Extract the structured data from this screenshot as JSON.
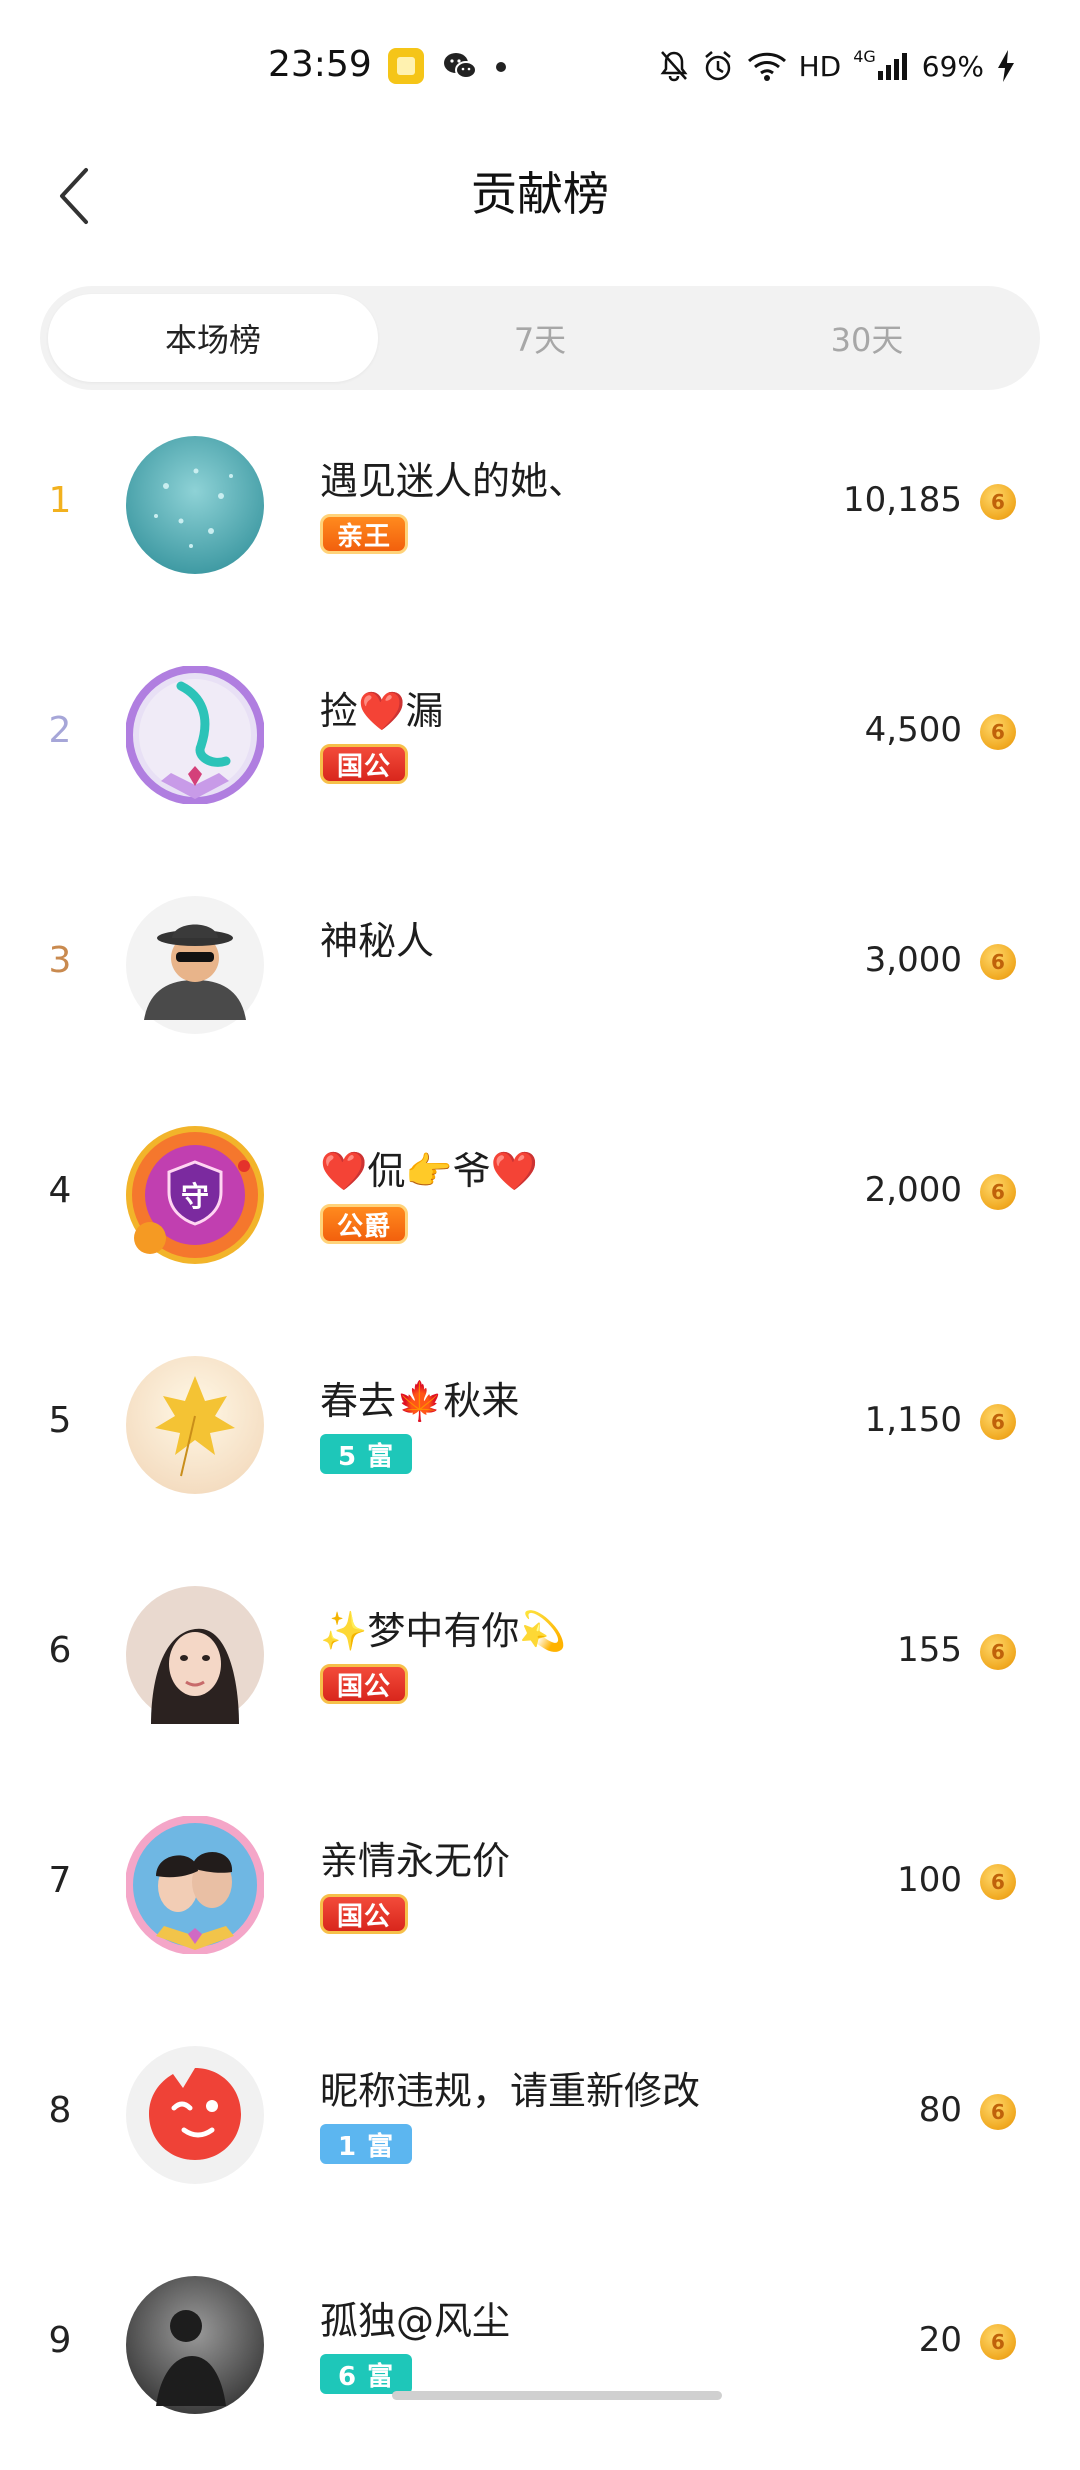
{
  "status_bar": {
    "time": "23:59",
    "network": "HD",
    "signal_type": "4G",
    "battery": "69%",
    "icons": [
      "app-yellow-icon",
      "wechat-icon",
      "dot-icon",
      "mute-icon",
      "alarm-icon",
      "wifi-icon",
      "signal-icon",
      "charging-icon"
    ]
  },
  "header": {
    "title": "贡献榜",
    "back_icon": "chevron-left-icon"
  },
  "tabs": [
    {
      "label": "本场榜",
      "active": true
    },
    {
      "label": "7天",
      "active": false
    },
    {
      "label": "30天",
      "active": false
    }
  ],
  "rows": [
    {
      "rank": "1",
      "name": "遇见迷人的她、",
      "badge": "亲王",
      "score": "10,185"
    },
    {
      "rank": "2",
      "name": "捡❤️漏",
      "badge": "国公",
      "score": "4,500"
    },
    {
      "rank": "3",
      "name": "神秘人",
      "badge": "",
      "score": "3,000"
    },
    {
      "rank": "4",
      "name": "❤️侃👉爷❤️",
      "badge": "公爵",
      "score": "2,000"
    },
    {
      "rank": "5",
      "name": "春去🍁秋来",
      "badge": "5 富",
      "score": "1,150"
    },
    {
      "rank": "6",
      "name": "✨梦中有你💫",
      "badge": "国公",
      "score": "155"
    },
    {
      "rank": "7",
      "name": "亲情永无价",
      "badge": "国公",
      "score": "100"
    },
    {
      "rank": "8",
      "name": "昵称违规，请重新修改",
      "badge": "1 富",
      "score": "80"
    },
    {
      "rank": "9",
      "name": "孤独@风尘",
      "badge": "6 富",
      "score": "20"
    }
  ],
  "avatar_badge_text": "守",
  "coin_glyph": "6",
  "colors": {
    "rank1": "#f2b11e",
    "rank2": "#a6a6d8",
    "rank3": "#c98a4f",
    "coin": "#f0a81f"
  }
}
